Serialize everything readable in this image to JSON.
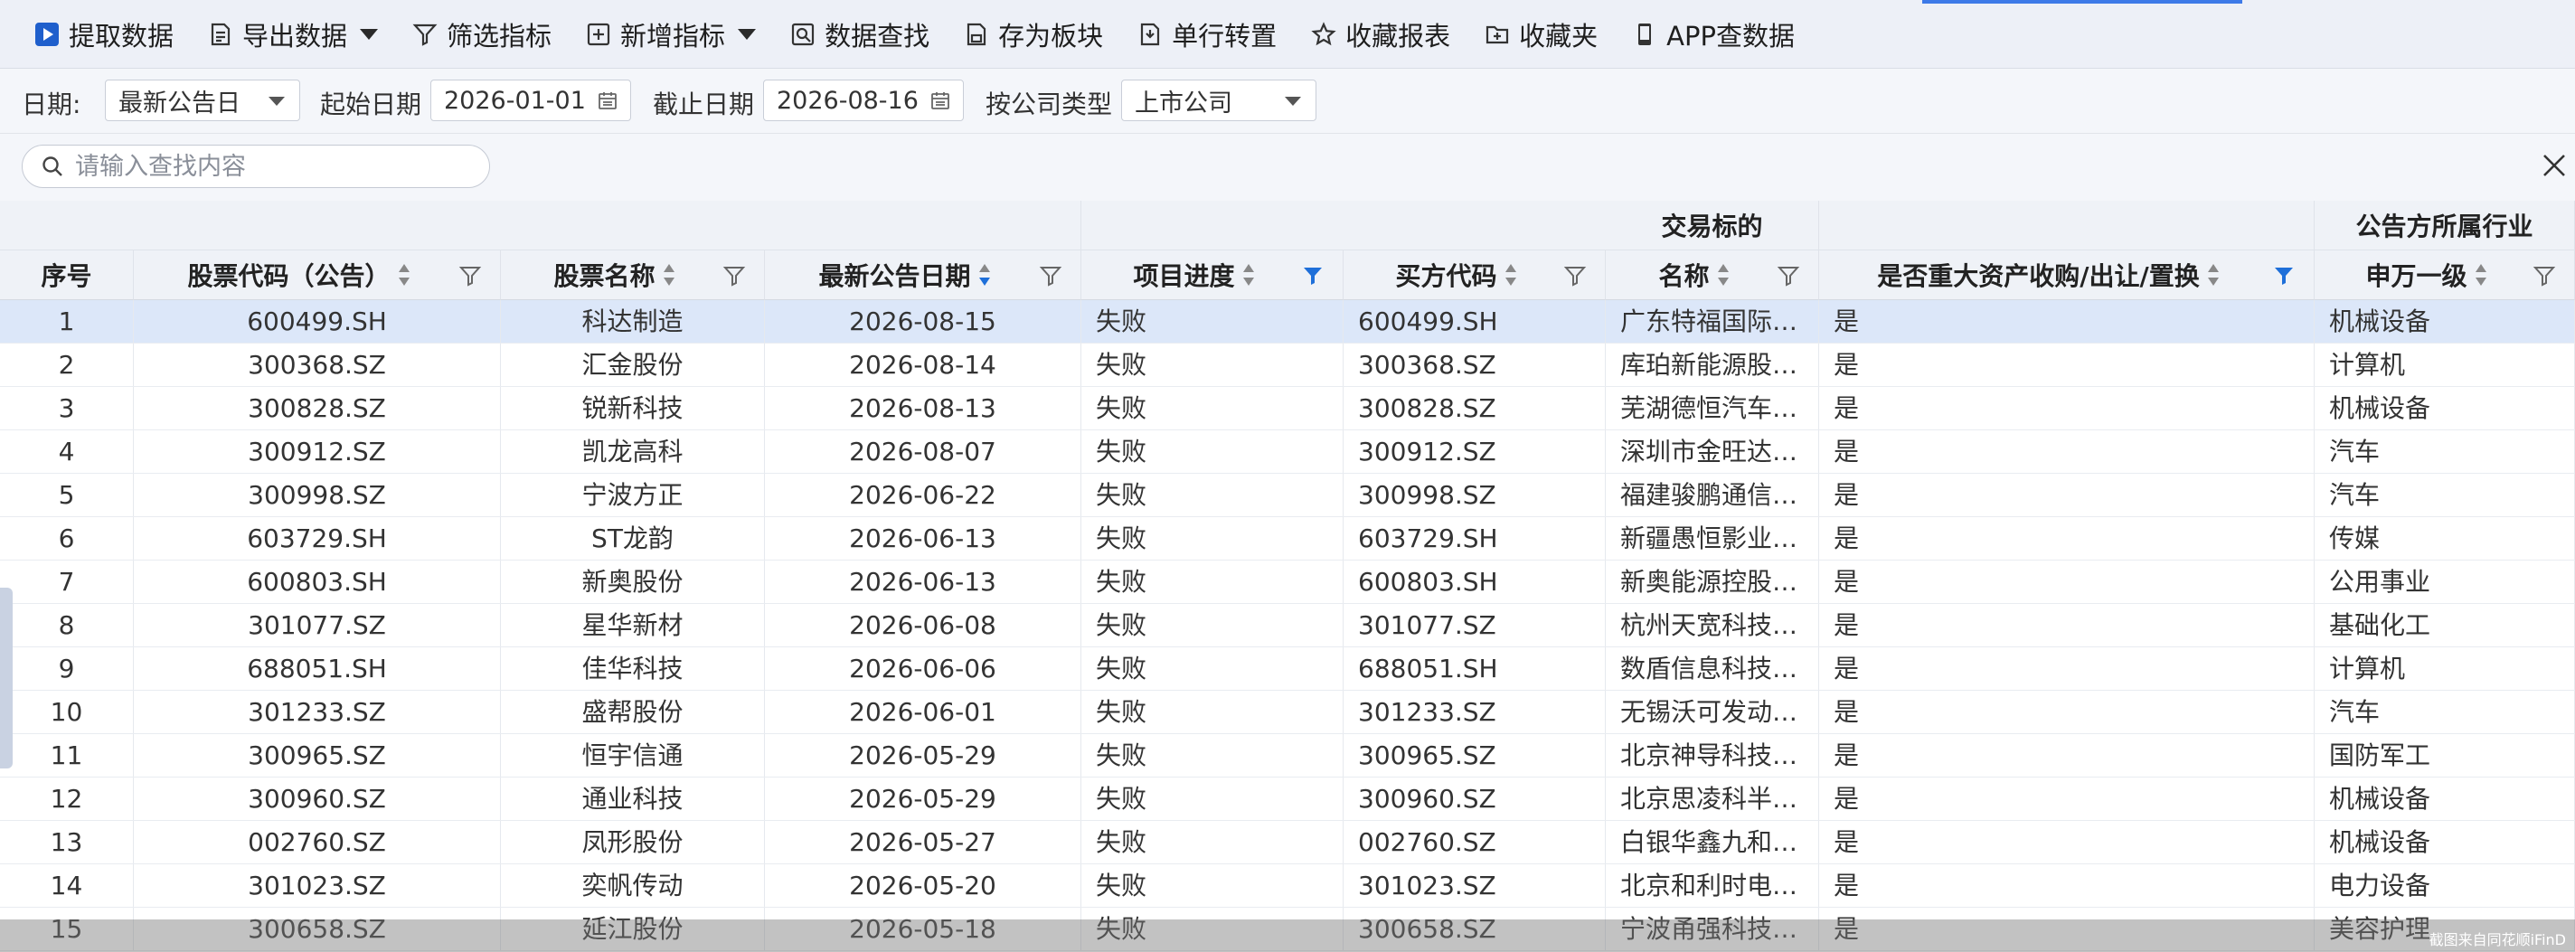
{
  "toolbar": {
    "items": [
      {
        "label": "提取数据",
        "icon": "play-icon"
      },
      {
        "label": "导出数据",
        "icon": "export-icon",
        "dropdown": true
      },
      {
        "label": "筛选指标",
        "icon": "funnel-icon"
      },
      {
        "label": "新增指标",
        "icon": "plus-box-icon",
        "dropdown": true
      },
      {
        "label": "数据查找",
        "icon": "search-doc-icon"
      },
      {
        "label": "存为板块",
        "icon": "save-doc-icon"
      },
      {
        "label": "单行转置",
        "icon": "transpose-icon"
      },
      {
        "label": "收藏报表",
        "icon": "star-icon"
      },
      {
        "label": "收藏夹",
        "icon": "folder-icon"
      },
      {
        "label": "APP查数据",
        "icon": "phone-icon"
      }
    ]
  },
  "filters": {
    "date_label": "日期:",
    "date_value": "最新公告日",
    "start_label": "起始日期",
    "start_value": "2026-01-01",
    "end_label": "截止日期",
    "end_value": "2026-08-16",
    "company_type_label": "按公司类型",
    "company_type_value": "上市公司"
  },
  "search": {
    "placeholder": "请输入查找内容"
  },
  "table": {
    "group_headers": {
      "target": "交易标的",
      "industry": "公告方所属行业"
    },
    "headers": {
      "seq": "序号",
      "code": "股票代码（公告）",
      "name": "股票名称",
      "date": "最新公告日期",
      "progress": "项目进度",
      "buyer": "买方代码",
      "target_name": "名称",
      "major": "是否重大资产收购/出让/置换",
      "industry": "申万一级"
    },
    "rows": [
      {
        "seq": "1",
        "code": "600499.SH",
        "name": "科达制造",
        "date": "2026-08-15",
        "progress": "失败",
        "buyer": "600499.SH",
        "target": "广东特福国际…",
        "major": "是",
        "industry": "机械设备"
      },
      {
        "seq": "2",
        "code": "300368.SZ",
        "name": "汇金股份",
        "date": "2026-08-14",
        "progress": "失败",
        "buyer": "300368.SZ",
        "target": "库珀新能源股…",
        "major": "是",
        "industry": "计算机"
      },
      {
        "seq": "3",
        "code": "300828.SZ",
        "name": "锐新科技",
        "date": "2026-08-13",
        "progress": "失败",
        "buyer": "300828.SZ",
        "target": "芜湖德恒汽车…",
        "major": "是",
        "industry": "机械设备"
      },
      {
        "seq": "4",
        "code": "300912.SZ",
        "name": "凯龙高科",
        "date": "2026-08-07",
        "progress": "失败",
        "buyer": "300912.SZ",
        "target": "深圳市金旺达…",
        "major": "是",
        "industry": "汽车"
      },
      {
        "seq": "5",
        "code": "300998.SZ",
        "name": "宁波方正",
        "date": "2026-06-22",
        "progress": "失败",
        "buyer": "300998.SZ",
        "target": "福建骏鹏通信…",
        "major": "是",
        "industry": "汽车"
      },
      {
        "seq": "6",
        "code": "603729.SH",
        "name": "ST龙韵",
        "date": "2026-06-13",
        "progress": "失败",
        "buyer": "603729.SH",
        "target": "新疆愚恒影业…",
        "major": "是",
        "industry": "传媒"
      },
      {
        "seq": "7",
        "code": "600803.SH",
        "name": "新奥股份",
        "date": "2026-06-13",
        "progress": "失败",
        "buyer": "600803.SH",
        "target": "新奥能源控股…",
        "major": "是",
        "industry": "公用事业"
      },
      {
        "seq": "8",
        "code": "301077.SZ",
        "name": "星华新材",
        "date": "2026-06-08",
        "progress": "失败",
        "buyer": "301077.SZ",
        "target": "杭州天宽科技…",
        "major": "是",
        "industry": "基础化工"
      },
      {
        "seq": "9",
        "code": "688051.SH",
        "name": "佳华科技",
        "date": "2026-06-06",
        "progress": "失败",
        "buyer": "688051.SH",
        "target": "数盾信息科技…",
        "major": "是",
        "industry": "计算机"
      },
      {
        "seq": "10",
        "code": "301233.SZ",
        "name": "盛帮股份",
        "date": "2026-06-01",
        "progress": "失败",
        "buyer": "301233.SZ",
        "target": "无锡沃可发动…",
        "major": "是",
        "industry": "汽车"
      },
      {
        "seq": "11",
        "code": "300965.SZ",
        "name": "恒宇信通",
        "date": "2026-05-29",
        "progress": "失败",
        "buyer": "300965.SZ",
        "target": "北京神导科技…",
        "major": "是",
        "industry": "国防军工"
      },
      {
        "seq": "12",
        "code": "300960.SZ",
        "name": "通业科技",
        "date": "2026-05-29",
        "progress": "失败",
        "buyer": "300960.SZ",
        "target": "北京思凌科半…",
        "major": "是",
        "industry": "机械设备"
      },
      {
        "seq": "13",
        "code": "002760.SZ",
        "name": "凤形股份",
        "date": "2026-05-27",
        "progress": "失败",
        "buyer": "002760.SZ",
        "target": "白银华鑫九和…",
        "major": "是",
        "industry": "机械设备"
      },
      {
        "seq": "14",
        "code": "301023.SZ",
        "name": "奕帆传动",
        "date": "2026-05-20",
        "progress": "失败",
        "buyer": "301023.SZ",
        "target": "北京和利时电…",
        "major": "是",
        "industry": "电力设备"
      },
      {
        "seq": "15",
        "code": "300658.SZ",
        "name": "延江股份",
        "date": "2026-05-18",
        "progress": "失败",
        "buyer": "300658.SZ",
        "target": "宁波甬强科技…",
        "major": "是",
        "industry": "美容护理"
      }
    ]
  },
  "watermark": "截图来自同花顺iFinD",
  "colors": {
    "accent": "#3d7ae8",
    "selected_row": "#dce7f9",
    "header_bg": "#eff2f7",
    "active_filter": "#1e6fd9"
  }
}
